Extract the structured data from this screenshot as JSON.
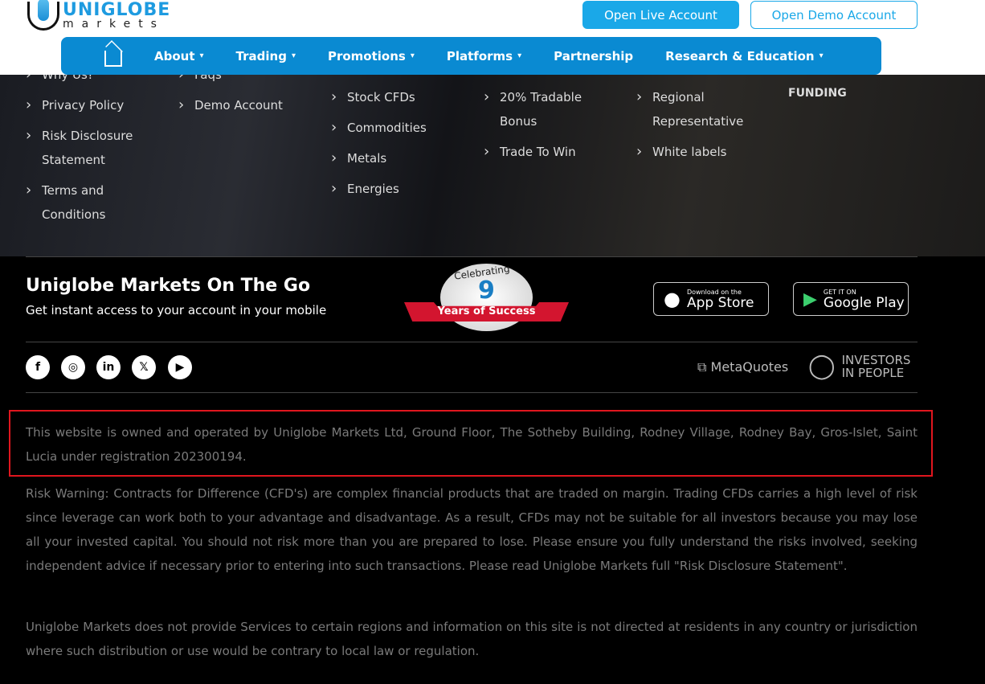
{
  "header": {
    "logo_top": "UNIGLOBE",
    "logo_bottom": "markets",
    "open_live": "Open Live Account",
    "open_demo": "Open Demo Account"
  },
  "nav": {
    "items": [
      {
        "label": "About",
        "chev": true
      },
      {
        "label": "Trading",
        "chev": true
      },
      {
        "label": "Promotions",
        "chev": true
      },
      {
        "label": "Platforms",
        "chev": true
      },
      {
        "label": "Partnership",
        "chev": false
      },
      {
        "label": "Research & Education",
        "chev": true
      }
    ]
  },
  "footer_links": {
    "col1": [
      "Why Us?",
      "Privacy Policy",
      "Risk Disclosure Statement",
      "Terms and Conditions"
    ],
    "col2": [
      "Faqs",
      "Demo Account"
    ],
    "col3": [
      "Stock CFDs",
      "Commodities",
      "Metals",
      "Energies"
    ],
    "col4": [
      "20% Tradable Bonus",
      "Trade To Win"
    ],
    "col5": [
      "Regional Representative",
      "White labels"
    ],
    "funding": "FUNDING"
  },
  "mobile": {
    "title": "Uniglobe Markets On The Go",
    "subtitle": "Get instant access to your account in your mobile",
    "badge_top": "Celebrating",
    "badge_num": "9",
    "badge_bottom": "Years of Success",
    "appstore_small": "Download on the",
    "appstore_big": "App Store",
    "gplay_small": "GET IT ON",
    "gplay_big": "Google Play"
  },
  "social": [
    "facebook",
    "instagram",
    "linkedin",
    "x",
    "youtube"
  ],
  "partners": {
    "metaquotes": "MetaQuotes",
    "iip1": "INVESTORS",
    "iip2": "IN PEOPLE"
  },
  "legal": {
    "owned": "This website is owned and operated by Uniglobe Markets Ltd, Ground Floor, The Sotheby Building, Rodney Village, Rodney Bay, Gros-Islet, Saint Lucia under registration 202300194.",
    "risk": "Risk Warning: Contracts for Difference (CFD's) are complex financial products that are traded on margin. Trading CFDs carries a high level of risk since leverage can work both to your advantage and disadvantage. As a result, CFDs may not be suitable for all investors because you may lose all your invested capital. You should not risk more than you are prepared to lose. Please ensure you fully understand the risks involved, seeking independent advice if necessary prior to entering into such transactions. Please read Uniglobe Markets full \"Risk Disclosure Statement\".",
    "regions": "Uniglobe Markets does not provide Services to certain regions and information on this site is not directed at residents in any country or jurisdiction where such distribution or use would be contrary to local law or regulation."
  }
}
